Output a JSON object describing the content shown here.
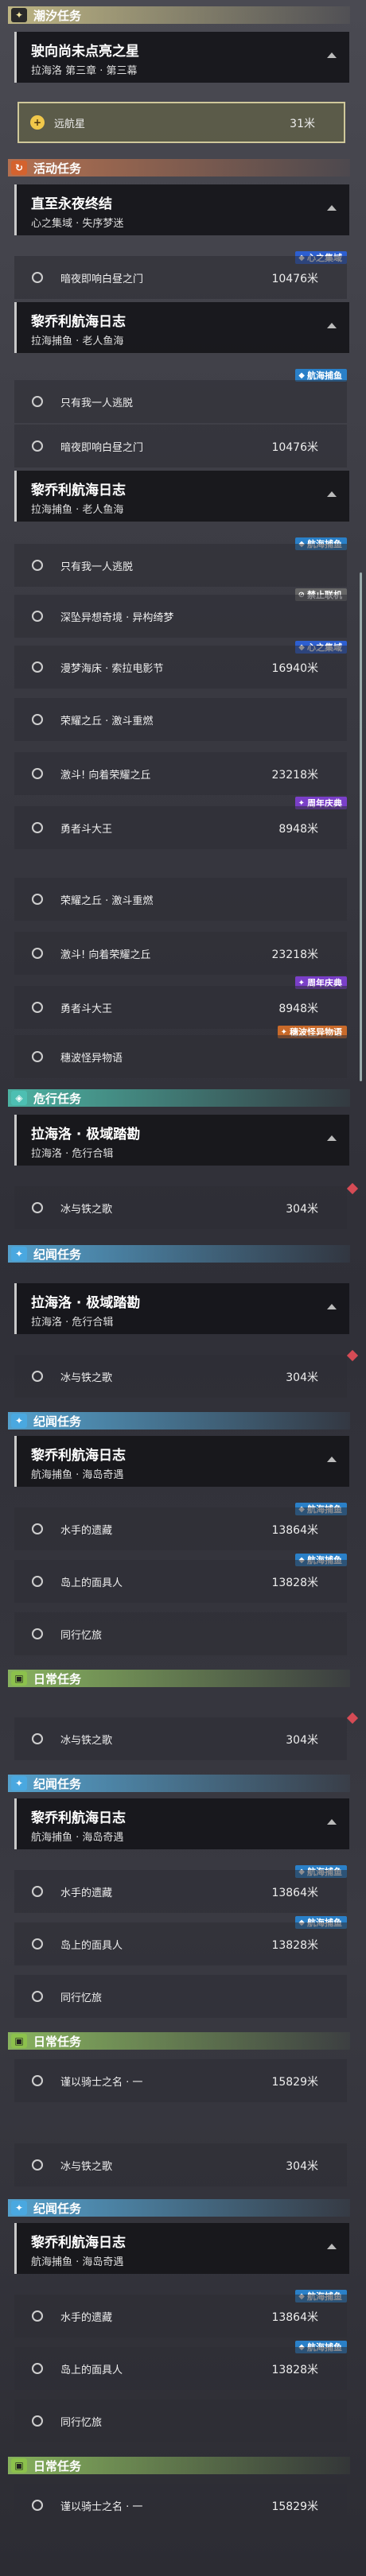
{
  "sections": {
    "dawn": "潮汐任务",
    "activity": "活动任务",
    "danger": "危行任务",
    "era": "纪闻任务",
    "daily": "日常任务"
  },
  "tasks": {
    "dawn_quest": {
      "title": "驶向尚未点亮之星",
      "sub": "拉海洛 第三章 · 第三幕"
    },
    "farstar": {
      "label": "远航星",
      "dist": "31米"
    },
    "eternal": {
      "title": "直至永夜终结",
      "sub": "心之集域 · 失序梦迷"
    },
    "lighthouse": {
      "label": "暗夜即响白昼之门",
      "dist": "10476米"
    },
    "lighthouse2": {
      "label": "暗夜即响白昼之门",
      "dist": "10476米"
    },
    "logbook": {
      "title": "黎乔利航海日志",
      "sub": "拉海捕鱼 · 老人鱼海"
    },
    "logbook2": {
      "title": "黎乔利航海日志",
      "sub": "拉海捕鱼 · 老人鱼海"
    },
    "onlyme": {
      "label": "只有我一人逃脱"
    },
    "onlyme2": {
      "label": "只有我一人逃脱"
    },
    "deepdream": {
      "label": "深坠异想奇境 · 异构绮梦"
    },
    "movie": {
      "label": "漫梦海床 · 索拉电影节",
      "dist": "16940米"
    },
    "glory": {
      "label": "荣耀之丘 · 激斗重燃"
    },
    "glory2": {
      "label": "荣耀之丘 · 激斗重燃"
    },
    "fight": {
      "label": "激斗! 向着荣耀之丘",
      "dist": "23218米"
    },
    "fight2": {
      "label": "激斗! 向着荣耀之丘",
      "dist": "23218米"
    },
    "brave": {
      "label": "勇者斗大王",
      "dist": "8948米"
    },
    "brave2": {
      "label": "勇者斗大王",
      "dist": "8948米"
    },
    "strange": {
      "label": "穗波怪异物语"
    },
    "lahailo": {
      "title": "拉海洛 · 极域踏勘",
      "sub": "拉海洛 · 危行合辑"
    },
    "lahailo2": {
      "title": "拉海洛 · 极域踏勘",
      "sub": "拉海洛 · 危行合辑"
    },
    "ice": {
      "label": "冰与铁之歌",
      "dist": "304米"
    },
    "logsea": {
      "title": "黎乔利航海日志",
      "sub": "航海捕鱼 · 海岛奇遇"
    },
    "wreck": {
      "label": "水手的遗藏",
      "dist": "13864米"
    },
    "mask": {
      "label": "岛上的面具人",
      "dist": "13828米"
    },
    "memory": {
      "label": "同行忆旅"
    },
    "knight": {
      "label": "谨以骑士之名 · 一",
      "dist": "15829米"
    }
  },
  "badges": {
    "heart": "心之集域",
    "sea": "航海捕鱼",
    "ban": "禁止联机",
    "fest": "周年庆典",
    "tale": "穗波怪异物语"
  }
}
